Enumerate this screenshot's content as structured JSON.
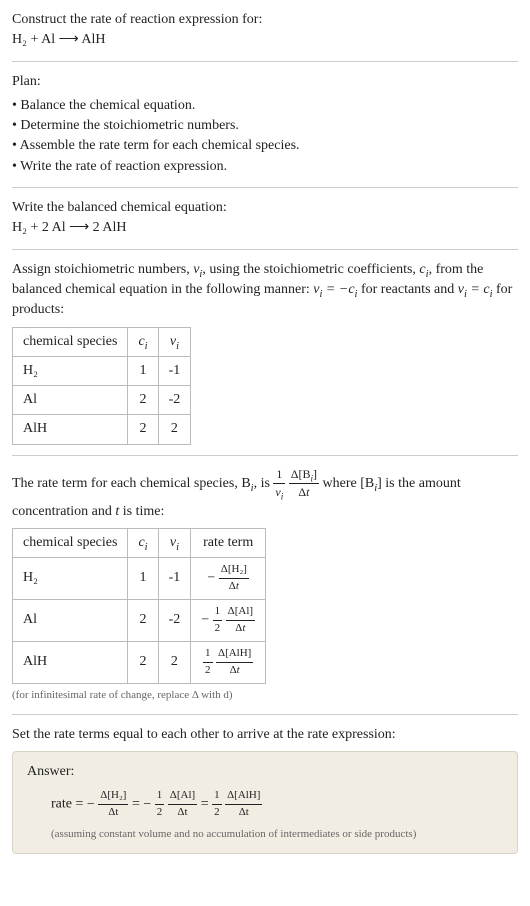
{
  "intro": {
    "prompt": "Construct the rate of reaction expression for:",
    "equation": "H₂ + Al ⟶ AlH"
  },
  "plan": {
    "heading": "Plan:",
    "items": [
      "Balance the chemical equation.",
      "Determine the stoichiometric numbers.",
      "Assemble the rate term for each chemical species.",
      "Write the rate of reaction expression."
    ]
  },
  "balanced": {
    "heading": "Write the balanced chemical equation:",
    "equation": "H₂ + 2 Al ⟶ 2 AlH"
  },
  "stoich": {
    "text_parts": {
      "a": "Assign stoichiometric numbers, ",
      "nu_i": "ν",
      "b": ", using the stoichiometric coefficients, ",
      "c_i": "c",
      "c": ", from the balanced chemical equation in the following manner: ",
      "d": " for reactants and ",
      "e": " for products:"
    },
    "table": {
      "headers": [
        "chemical species",
        "cᵢ",
        "νᵢ"
      ],
      "rows": [
        {
          "species": "H₂",
          "c": "1",
          "nu": "-1"
        },
        {
          "species": "Al",
          "c": "2",
          "nu": "-2"
        },
        {
          "species": "AlH",
          "c": "2",
          "nu": "2"
        }
      ]
    }
  },
  "rate_term": {
    "text_parts": {
      "a": "The rate term for each chemical species, B",
      "b": ", is ",
      "c": " where [B",
      "d": "] is the amount concentration and ",
      "t": "t",
      "e": " is time:"
    },
    "table": {
      "headers": [
        "chemical species",
        "cᵢ",
        "νᵢ",
        "rate term"
      ],
      "rows": [
        {
          "species": "H₂",
          "c": "1",
          "nu": "-1",
          "sign": "−",
          "coef_num": "",
          "coef_den": "",
          "delta": "Δ[H₂]"
        },
        {
          "species": "Al",
          "c": "2",
          "nu": "-2",
          "sign": "−",
          "coef_num": "1",
          "coef_den": "2",
          "delta": "Δ[Al]"
        },
        {
          "species": "AlH",
          "c": "2",
          "nu": "2",
          "sign": "",
          "coef_num": "1",
          "coef_den": "2",
          "delta": "Δ[AlH]"
        }
      ]
    },
    "note": "(for infinitesimal rate of change, replace Δ with d)"
  },
  "final": {
    "heading": "Set the rate terms equal to each other to arrive at the rate expression:",
    "answer_label": "Answer:",
    "rate_prefix": "rate = ",
    "terms": {
      "h2": {
        "sign": "−",
        "coef_num": "",
        "coef_den": "",
        "delta": "Δ[H₂]"
      },
      "al": {
        "sign": "−",
        "coef_num": "1",
        "coef_den": "2",
        "delta": "Δ[Al]"
      },
      "alh": {
        "sign": "",
        "coef_num": "1",
        "coef_den": "2",
        "delta": "Δ[AlH]"
      }
    },
    "dt": "Δt",
    "eq": " = ",
    "assume": "(assuming constant volume and no accumulation of intermediates or side products)"
  },
  "chart_data": {
    "type": "table",
    "tables": [
      {
        "title": "Stoichiometric numbers",
        "columns": [
          "chemical species",
          "c_i",
          "nu_i"
        ],
        "rows": [
          [
            "H2",
            1,
            -1
          ],
          [
            "Al",
            2,
            -2
          ],
          [
            "AlH",
            2,
            2
          ]
        ]
      },
      {
        "title": "Rate terms",
        "columns": [
          "chemical species",
          "c_i",
          "nu_i",
          "rate term"
        ],
        "rows": [
          [
            "H2",
            1,
            -1,
            "-(Δ[H2]/Δt)"
          ],
          [
            "Al",
            2,
            -2,
            "-(1/2)(Δ[Al]/Δt)"
          ],
          [
            "AlH",
            2,
            2,
            "(1/2)(Δ[AlH]/Δt)"
          ]
        ]
      }
    ]
  }
}
